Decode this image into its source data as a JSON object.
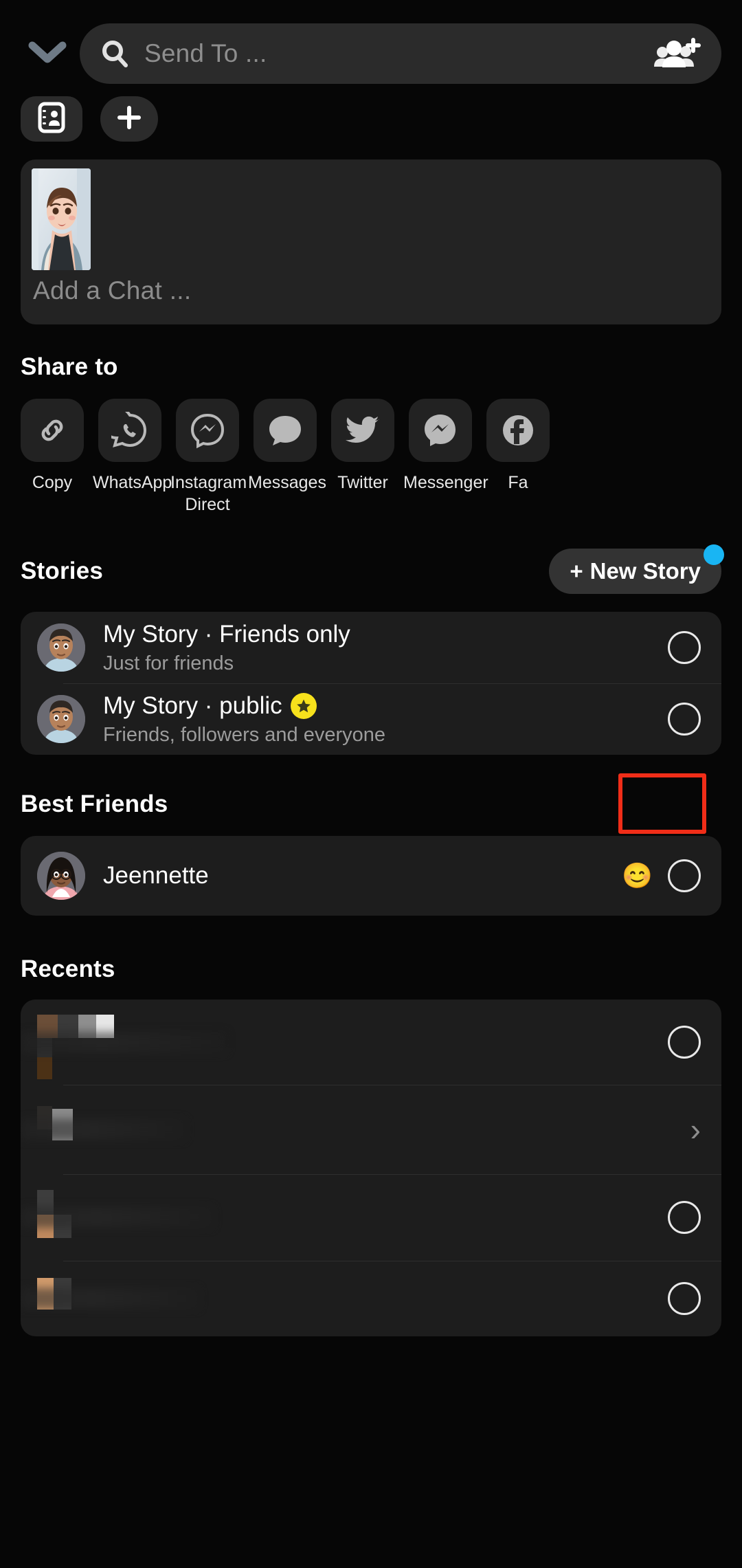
{
  "header": {
    "collapse_icon": "chevron-down-icon",
    "search": {
      "placeholder": "Send To ...",
      "value": "",
      "icon": "search-icon"
    },
    "group_add_icon": "group-add-icon"
  },
  "quick_actions": [
    {
      "name": "contact-card-button",
      "icon": "contact-card-icon"
    },
    {
      "name": "add-button",
      "icon": "plus-icon"
    }
  ],
  "chat_preview": {
    "thumbnail_alt": "snap-thumbnail",
    "add_chat_placeholder": "Add a Chat ..."
  },
  "share": {
    "title": "Share to",
    "items": [
      {
        "label": "Copy",
        "icon": "link-icon"
      },
      {
        "label": "WhatsApp",
        "icon": "whatsapp-icon"
      },
      {
        "label": "Instagram Direct",
        "icon": "instagram-direct-icon"
      },
      {
        "label": "Messages",
        "icon": "message-bubble-icon"
      },
      {
        "label": "Twitter",
        "icon": "twitter-icon"
      },
      {
        "label": "Messenger",
        "icon": "messenger-icon"
      },
      {
        "label": "Fa",
        "icon": "facebook-icon"
      }
    ]
  },
  "stories": {
    "title": "Stories",
    "new_story_button": {
      "label": "New Story",
      "plus": "+",
      "badge_color": "#19b5f3"
    },
    "rows": [
      {
        "title": "My Story · Friends only",
        "subtitle": "Just for friends",
        "selected": false,
        "badge": null,
        "highlighted": true
      },
      {
        "title": "My Story · public",
        "subtitle": "Friends, followers and everyone",
        "selected": false,
        "badge": "star",
        "highlighted": false
      }
    ]
  },
  "best_friends": {
    "title": "Best Friends",
    "rows": [
      {
        "name": "Jeennette",
        "emoji": "😊",
        "selected": false
      }
    ]
  },
  "recents": {
    "title": "Recents",
    "rows": [
      {
        "name": "",
        "redacted": true,
        "control": "radio"
      },
      {
        "name": "",
        "redacted": true,
        "control": "chevron"
      },
      {
        "name": "",
        "redacted": true,
        "control": "radio"
      },
      {
        "name": "",
        "redacted": true,
        "control": "radio"
      }
    ]
  },
  "annotation": {
    "color": "#f02d18",
    "target": "story-row-friends-only-radio"
  }
}
